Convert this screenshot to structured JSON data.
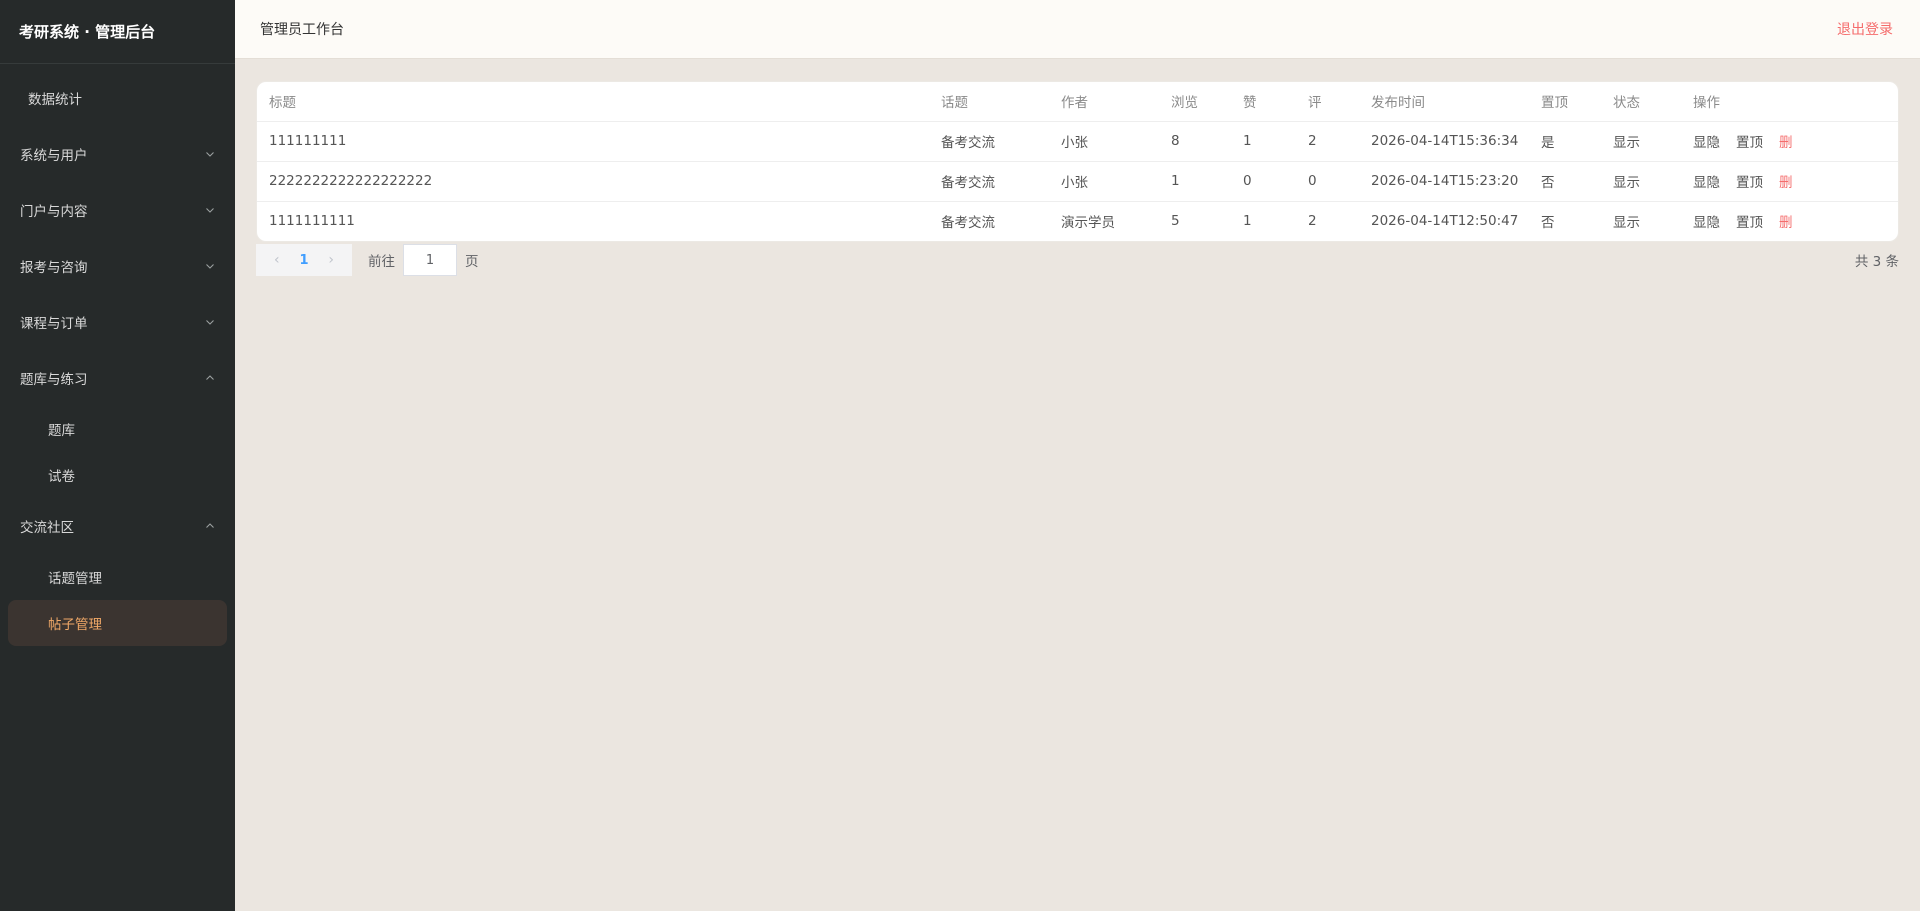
{
  "sidebar": {
    "brand": "考研系统 · 管理后台",
    "stat": "数据统计",
    "groups": [
      {
        "label": "系统与用户"
      },
      {
        "label": "门户与内容"
      },
      {
        "label": "报考与咨询"
      },
      {
        "label": "课程与订单"
      },
      {
        "label": "题库与练习",
        "children": [
          {
            "label": "题库"
          },
          {
            "label": "试卷"
          }
        ]
      },
      {
        "label": "交流社区",
        "children": [
          {
            "label": "话题管理"
          },
          {
            "label": "帖子管理"
          }
        ]
      }
    ]
  },
  "header": {
    "title": "管理员工作台",
    "logout": "退出登录"
  },
  "table": {
    "columns": [
      "标题",
      "话题",
      "作者",
      "浏览",
      "赞",
      "评",
      "发布时间",
      "置顶",
      "状态",
      "操作"
    ],
    "rows": [
      {
        "title": "111111111",
        "topic": "备考交流",
        "author": "小张",
        "views": "8",
        "likes": "1",
        "comments": "2",
        "time": "2026-04-14T15:36:34",
        "pinned": "是",
        "status": "显示"
      },
      {
        "title": "2222222222222222222",
        "topic": "备考交流",
        "author": "小张",
        "views": "1",
        "likes": "0",
        "comments": "0",
        "time": "2026-04-14T15:23:20",
        "pinned": "否",
        "status": "显示"
      },
      {
        "title": "1111111111",
        "topic": "备考交流",
        "author": "演示学员",
        "views": "5",
        "likes": "1",
        "comments": "2",
        "time": "2026-04-14T12:50:47",
        "pinned": "否",
        "status": "显示"
      }
    ],
    "actions": {
      "toggle": "显隐",
      "pin": "置顶",
      "delete": "删"
    }
  },
  "pager": {
    "current": "1",
    "goto_label": "前往",
    "goto_value": "1",
    "goto_suffix": "页",
    "total": "共 3 条"
  },
  "colors": {
    "sidebar_bg": "#262a2a",
    "active_text": "#f0a867",
    "danger": "#f56c6c",
    "primary": "#409eff",
    "content_bg": "#ebe6e0"
  }
}
